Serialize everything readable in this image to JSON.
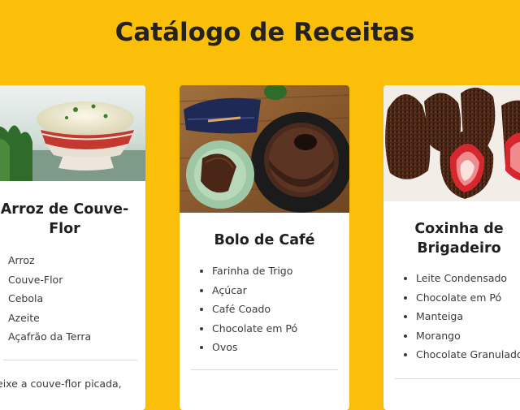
{
  "page": {
    "title": "Catálogo de Receitas"
  },
  "recipes": [
    {
      "title": "Arroz de Couve-Flor",
      "image": "cauliflower-rice-bowl-photo",
      "ingredients": [
        "Arroz",
        "Couve-Flor",
        "Cebola",
        "Azeite",
        "Açafrão da Terra"
      ],
      "method": "eixe a couve-flor picada,"
    },
    {
      "title": "Bolo de Café",
      "image": "coffee-bundt-cake-photo",
      "ingredients": [
        "Farinha de Trigo",
        "Açúcar",
        "Café Coado",
        "Chocolate em Pó",
        "Ovos"
      ],
      "method": ""
    },
    {
      "title": "Coxinha de Brigadeiro",
      "image": "strawberry-brigadeiro-photo",
      "ingredients": [
        "Leite Condensado",
        "Chocolate em Pó",
        "Manteiga",
        "Morango",
        "Chocolate Granulado"
      ],
      "method": ""
    }
  ],
  "colors": {
    "background": "#fbbf0a",
    "card": "#ffffff",
    "text": "#2b2b2b"
  }
}
